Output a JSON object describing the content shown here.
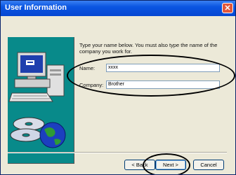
{
  "window": {
    "title": "User Information"
  },
  "instructions": "Type your name below. You must also type the name of the company you work for.",
  "form": {
    "name_label": "Name:",
    "name_value": "xxxx",
    "company_label": "Company:",
    "company_value": "Brother"
  },
  "buttons": {
    "back": "< Back",
    "next": "Next >",
    "cancel": "Cancel"
  },
  "colors": {
    "title_bar": "#0a55e2",
    "side_art_bg": "#088a8a",
    "close_button": "#e2563a"
  },
  "icons": [
    "close-icon",
    "computer-illustration",
    "disc-icon",
    "globe-icon"
  ]
}
